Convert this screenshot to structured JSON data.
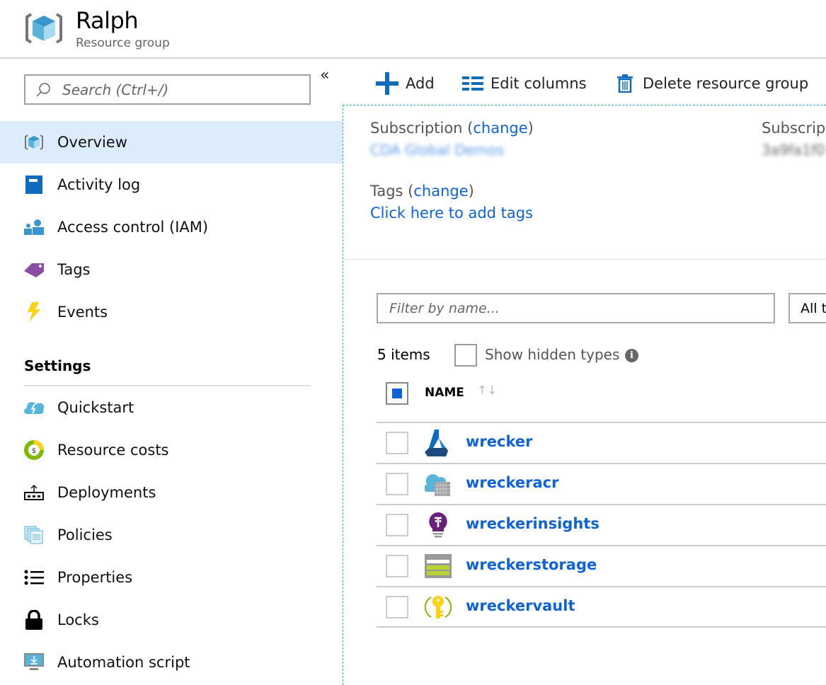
{
  "header": {
    "title": "Ralph",
    "subtitle": "Resource group"
  },
  "sidebar": {
    "search_placeholder": "Search (Ctrl+/)",
    "collapse": "«",
    "items": [
      {
        "label": "Overview",
        "icon": "resource-group-icon",
        "selected": true
      },
      {
        "label": "Activity log",
        "icon": "activity-log-icon"
      },
      {
        "label": "Access control (IAM)",
        "icon": "iam-icon"
      },
      {
        "label": "Tags",
        "icon": "tag-icon"
      },
      {
        "label": "Events",
        "icon": "lightning-icon"
      }
    ],
    "settings_heading": "Settings",
    "settings_items": [
      {
        "label": "Quickstart",
        "icon": "quickstart-cloud-icon"
      },
      {
        "label": "Resource costs",
        "icon": "cost-icon"
      },
      {
        "label": "Deployments",
        "icon": "deployments-icon"
      },
      {
        "label": "Policies",
        "icon": "policies-icon"
      },
      {
        "label": "Properties",
        "icon": "list-icon"
      },
      {
        "label": "Locks",
        "icon": "lock-icon"
      },
      {
        "label": "Automation script",
        "icon": "automation-monitor-icon"
      }
    ]
  },
  "toolbar": {
    "add": "Add",
    "edit_columns": "Edit columns",
    "delete": "Delete resource group"
  },
  "essentials": {
    "subscription_label": "Subscription (",
    "change": "change",
    "close_paren": ")",
    "subscription_value": "CDA Global Demos",
    "subscription_id_label": "Subscrip",
    "subscription_id_value": "3a9fa1f0",
    "tags_label": "Tags (",
    "add_tags": "Click here to add tags"
  },
  "resources": {
    "filter_placeholder": "Filter by name...",
    "type_filter": "All t",
    "count": "5 items",
    "show_hidden": "Show hidden types",
    "info": "i",
    "column_name": "NAME",
    "sort": "↑↓",
    "rows": [
      {
        "name": "wrecker",
        "icon": "machine-learning-icon"
      },
      {
        "name": "wreckeracr",
        "icon": "container-registry-icon"
      },
      {
        "name": "wreckerinsights",
        "icon": "app-insights-bulb-icon"
      },
      {
        "name": "wreckerstorage",
        "icon": "storage-icon"
      },
      {
        "name": "wreckervault",
        "icon": "key-vault-icon"
      }
    ]
  },
  "colors": {
    "accent": "#0f62d8",
    "selected_bg": "#dcecfc"
  }
}
